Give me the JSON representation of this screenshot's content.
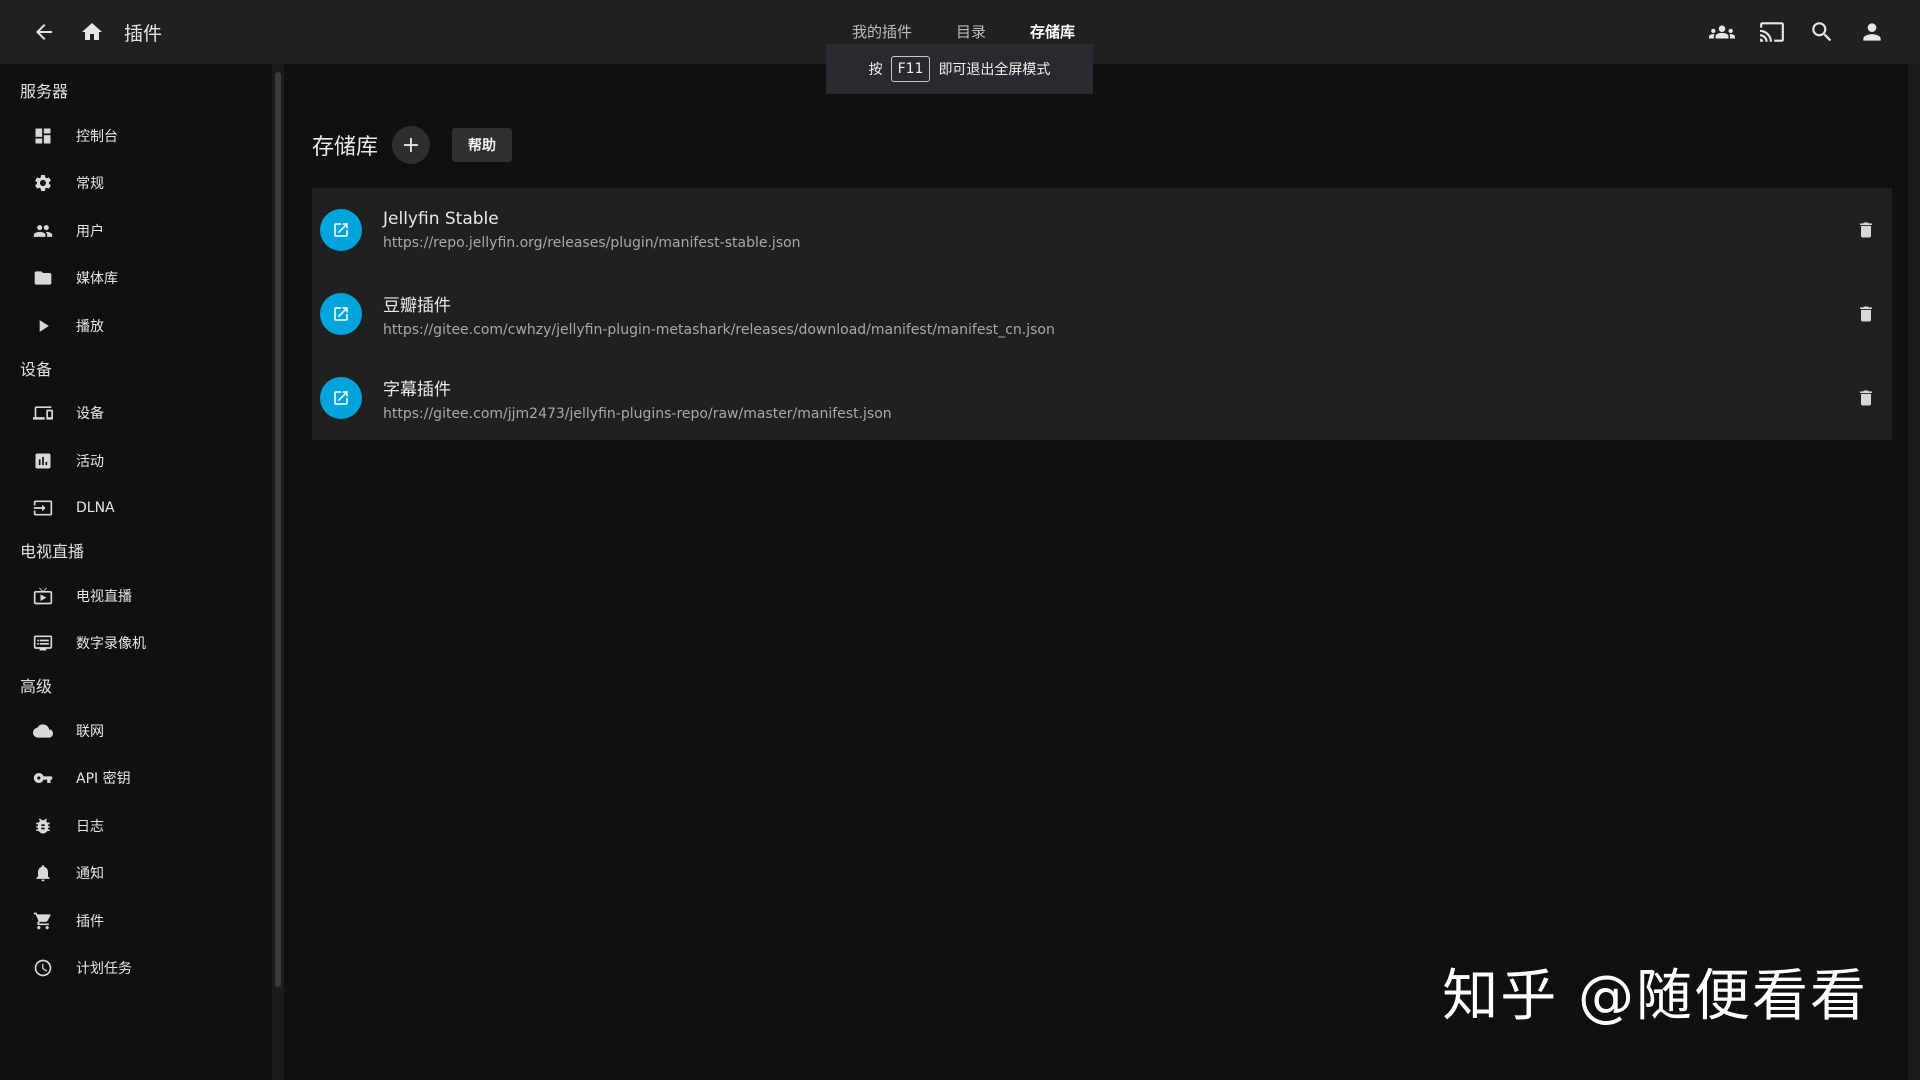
{
  "header": {
    "title": "插件",
    "back_icon": "back-arrow-icon",
    "home_icon": "home-icon",
    "tabs": [
      {
        "label": "我的插件",
        "active": false
      },
      {
        "label": "目录",
        "active": false
      },
      {
        "label": "存储库",
        "active": true
      }
    ],
    "right_icons": [
      "users-icon",
      "cast-icon",
      "search-icon",
      "user-icon"
    ]
  },
  "fullscreen_toast": {
    "prefix": "按",
    "key": "F11",
    "suffix": "即可退出全屏模式"
  },
  "sidebar": {
    "sections": [
      {
        "title": "服务器",
        "items": [
          {
            "label": "控制台",
            "icon": "dashboard-icon"
          },
          {
            "label": "常规",
            "icon": "gear-icon"
          },
          {
            "label": "用户",
            "icon": "users-icon"
          },
          {
            "label": "媒体库",
            "icon": "folder-icon"
          },
          {
            "label": "播放",
            "icon": "play-icon"
          }
        ]
      },
      {
        "title": "设备",
        "items": [
          {
            "label": "设备",
            "icon": "devices-icon"
          },
          {
            "label": "活动",
            "icon": "activity-icon"
          },
          {
            "label": "DLNA",
            "icon": "input-icon"
          }
        ]
      },
      {
        "title": "电视直播",
        "items": [
          {
            "label": "电视直播",
            "icon": "live-tv-icon"
          },
          {
            "label": "数字录像机",
            "icon": "dvr-icon"
          }
        ]
      },
      {
        "title": "高级",
        "items": [
          {
            "label": "联网",
            "icon": "cloud-icon"
          },
          {
            "label": "API 密钥",
            "icon": "key-icon"
          },
          {
            "label": "日志",
            "icon": "bug-icon"
          },
          {
            "label": "通知",
            "icon": "bell-icon"
          },
          {
            "label": "插件",
            "icon": "cart-icon"
          },
          {
            "label": "计划任务",
            "icon": "clock-icon"
          }
        ]
      }
    ]
  },
  "main": {
    "page_title": "存储库",
    "add_label": "+",
    "help_label": "帮助",
    "repositories": [
      {
        "name": "Jellyfin Stable",
        "url": "https://repo.jellyfin.org/releases/plugin/manifest-stable.json"
      },
      {
        "name": "豆瓣插件",
        "url": "https://gitee.com/cwhzy/jellyfin-plugin-metashark/releases/download/manifest/manifest_cn.json"
      },
      {
        "name": "字幕插件",
        "url": "https://gitee.com/jjm2473/jellyfin-plugins-repo/raw/master/manifest.json"
      }
    ]
  },
  "watermark": "知乎 @随便看看"
}
